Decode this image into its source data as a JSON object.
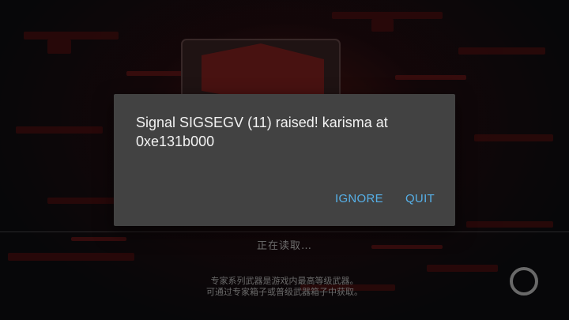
{
  "dialog": {
    "message": "Signal SIGSEGV (11) raised! karisma at 0xe131b000",
    "buttons": {
      "ignore_label": "IGNORE",
      "quit_label": "QUIT"
    },
    "background_color": "#424242",
    "button_color": "#56b0e8"
  },
  "loading": {
    "status_text": "正在读取…",
    "tip_lines": [
      "专家系列武器是游戏内最高等级武器。",
      "可通过专家箱子或普级武器箱子中获取。"
    ],
    "spinner_icon": "loading-ring-icon"
  }
}
